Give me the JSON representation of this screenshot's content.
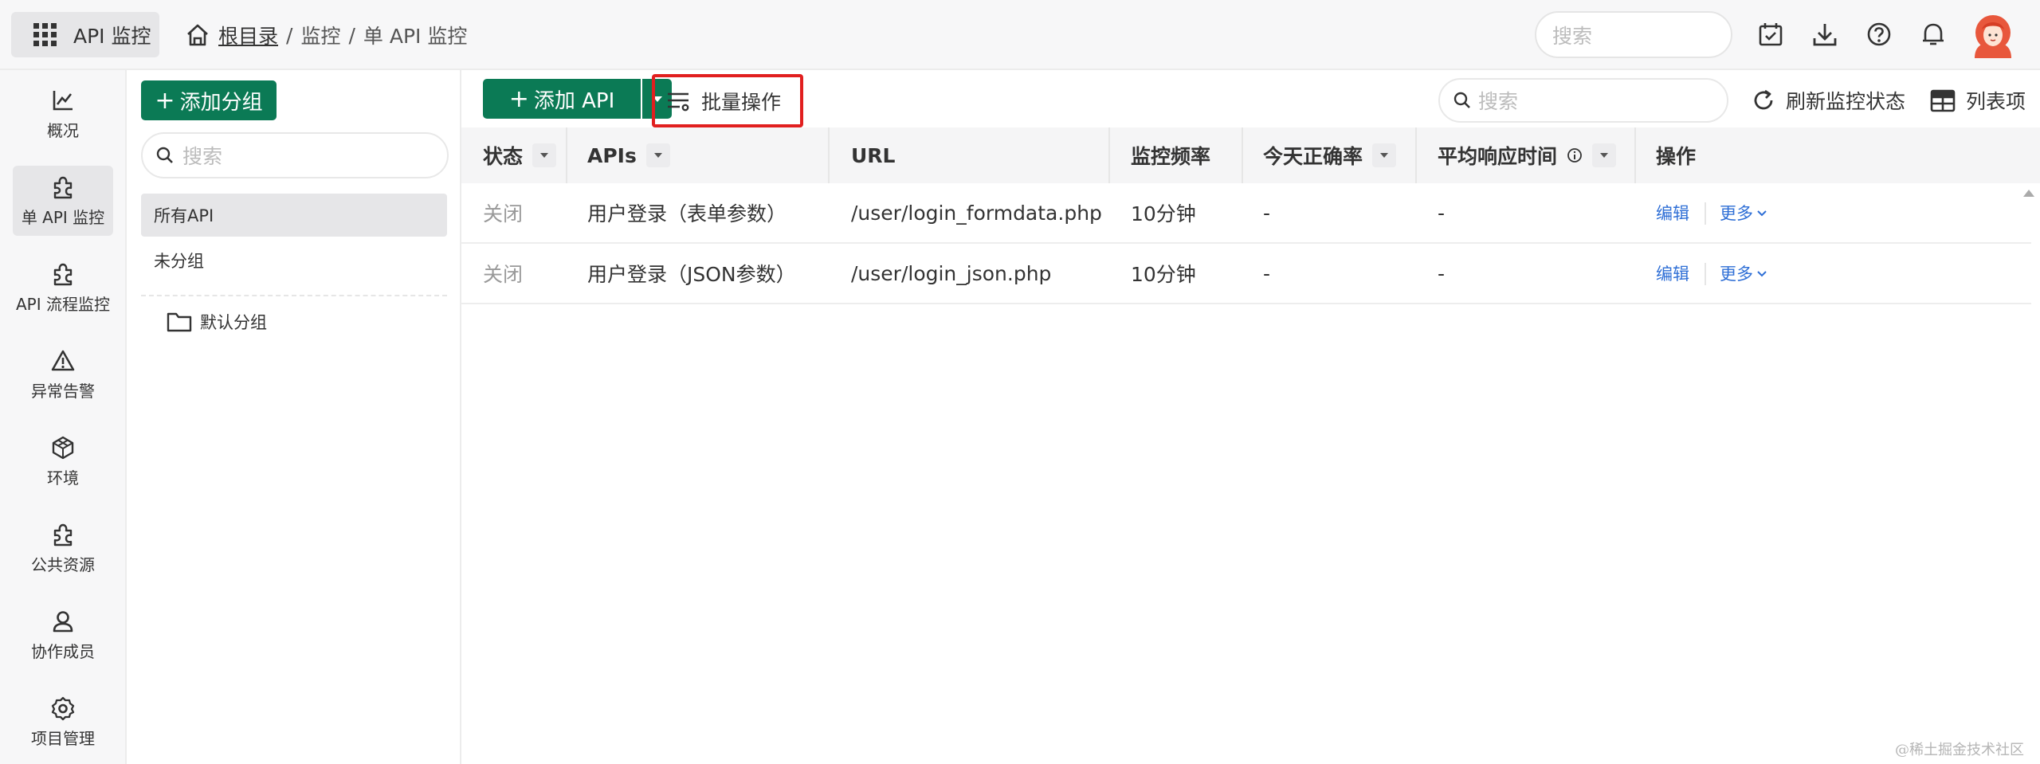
{
  "topbar": {
    "app_title": "API 监控",
    "breadcrumb": {
      "root": "根目录",
      "sep1": "/",
      "monitor": "监控",
      "sep2": "/",
      "current": "单 API 监控"
    },
    "search_placeholder": "搜索",
    "icons": [
      "calendar-check-icon",
      "download-icon",
      "help-icon",
      "bell-icon"
    ]
  },
  "sidebar": {
    "items": [
      {
        "label": "概况",
        "icon": "chart-line-icon"
      },
      {
        "label": "单 API 监控",
        "icon": "puzzle-icon",
        "active": true
      },
      {
        "label": "API 流程监控",
        "icon": "puzzle-icon"
      },
      {
        "label": "异常告警",
        "icon": "warning-icon"
      },
      {
        "label": "环境",
        "icon": "cube-icon"
      },
      {
        "label": "公共资源",
        "icon": "puzzle-icon"
      },
      {
        "label": "协作成员",
        "icon": "user-icon"
      },
      {
        "label": "项目管理",
        "icon": "gear-icon"
      }
    ]
  },
  "groups": {
    "add_label": "添加分组",
    "search_placeholder": "搜索",
    "items": [
      {
        "label": "所有API",
        "active": true
      },
      {
        "label": "未分组"
      }
    ],
    "folders": [
      {
        "label": "默认分组"
      }
    ]
  },
  "main": {
    "add_api_label": "添加 API",
    "batch_label": "批量操作",
    "search_placeholder": "搜索",
    "refresh_label": "刷新监控状态",
    "columns_label": "列表项",
    "table": {
      "headers": {
        "status": "状态",
        "apis": "APIs",
        "url": "URL",
        "freq": "监控频率",
        "accuracy": "今天正确率",
        "avg_time": "平均响应时间",
        "ops": "操作"
      },
      "rows": [
        {
          "status": "关闭",
          "name": "用户登录（表单参数）",
          "url": "/user/login_formdata.php",
          "freq": "10分钟",
          "accuracy": "-",
          "avg_time": "-",
          "edit": "编辑",
          "more": "更多"
        },
        {
          "status": "关闭",
          "name": "用户登录（JSON参数）",
          "url": "/user/login_json.php",
          "freq": "10分钟",
          "accuracy": "-",
          "avg_time": "-",
          "edit": "编辑",
          "more": "更多"
        }
      ]
    }
  },
  "watermark": "@稀土掘金技术社区",
  "colors": {
    "primary_green": "#0b7a55",
    "highlight_red": "#e11f1f",
    "link_blue": "#2f6fd6"
  }
}
